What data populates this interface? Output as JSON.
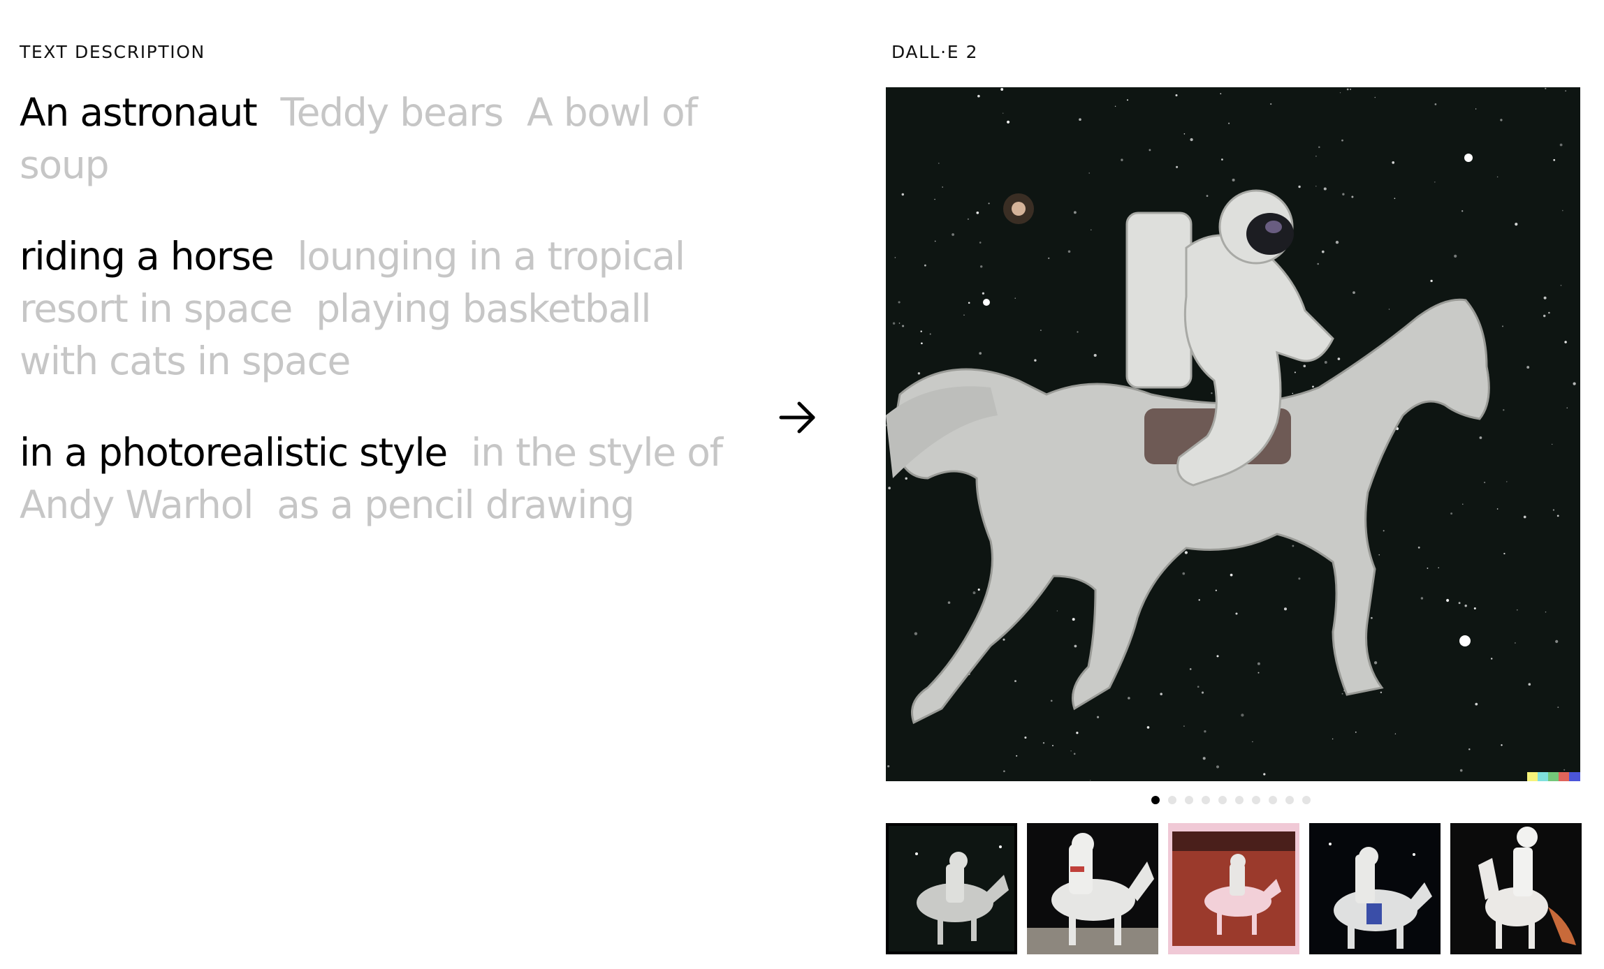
{
  "left_label": "TEXT DESCRIPTION",
  "right_label": "DALL·E 2",
  "groups": {
    "subject": {
      "options": [
        "An astronaut",
        "Teddy bears",
        "A bowl of soup"
      ],
      "selected": 0
    },
    "action": {
      "options": [
        "riding a horse",
        "lounging in a tropical resort in space",
        "playing basketball with cats in space"
      ],
      "selected": 0
    },
    "style": {
      "options": [
        "in a photorealistic style",
        "in the style of Andy Warhol",
        "as a pencil drawing"
      ],
      "selected": 0
    }
  },
  "icons": {
    "arrow": "arrow-right-icon"
  },
  "carousel": {
    "total": 10,
    "current": 0
  },
  "thumbnails": [
    {
      "variant": "space-white-horse",
      "selected": true
    },
    {
      "variant": "moon-surface-white-horse",
      "selected": false
    },
    {
      "variant": "mars-pink-horse",
      "selected": false
    },
    {
      "variant": "space-blue-saddle",
      "selected": false
    },
    {
      "variant": "space-rearing-horse",
      "selected": false
    }
  ],
  "colors": {
    "active_text": "#000000",
    "inactive_text": "#c6c6c6",
    "space_bg": "#0e1512"
  }
}
